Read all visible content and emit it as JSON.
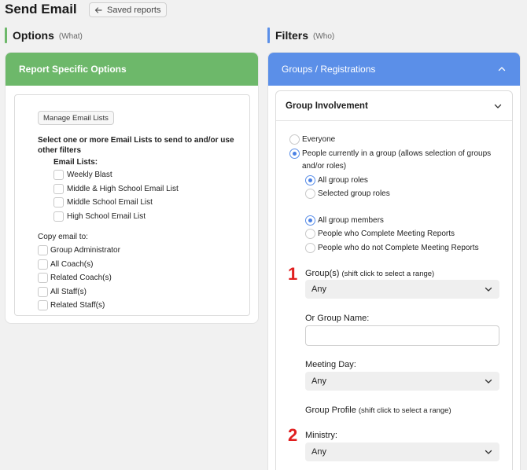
{
  "header": {
    "title": "Send Email",
    "back_label": "Saved reports"
  },
  "options_section": {
    "title": "Options",
    "subtitle": "(What)",
    "accent": "#6db86a"
  },
  "filters_section": {
    "title": "Filters",
    "subtitle": "(Who)",
    "accent": "#5b8fe8"
  },
  "report_options": {
    "title": "Report Specific Options",
    "manage_button": "Manage Email Lists",
    "instruction_line1": "Select one or more Email Lists to send to and/or use",
    "instruction_line2": "other filters",
    "email_lists_label": "Email Lists:",
    "email_lists": [
      "Weekly Blast",
      "Middle & High School Email List",
      "Middle School Email List",
      "High School Email List"
    ],
    "copy_label": "Copy email to:",
    "copy_options": [
      "Group Administrator",
      "All Coach(s)",
      "Related Coach(s)",
      "All Staff(s)",
      "Related Staff(s)"
    ]
  },
  "groups_panel": {
    "title": "Groups / Registrations",
    "involvement_title": "Group Involvement",
    "radio_everyone": "Everyone",
    "radio_in_group_line1": "People currently in a group (allows selection of groups",
    "radio_in_group_line2": "and/or roles)",
    "role_options": [
      "All group roles",
      "Selected group roles"
    ],
    "member_options": [
      "All group members",
      "People who Complete Meeting Reports",
      "People who do not Complete Meeting Reports"
    ],
    "groups_label": "Group(s)",
    "groups_hint": "(shift click to select a range)",
    "groups_value": "Any",
    "group_name_label": "Or Group Name:",
    "group_name_value": "",
    "meeting_day_label": "Meeting Day:",
    "meeting_day_value": "Any",
    "profile_label": "Group Profile",
    "profile_hint": "(shift click to select a range)",
    "ministry_label": "Ministry:",
    "ministry_value": "Any",
    "marker_1": "1",
    "marker_2": "2"
  },
  "icons": [
    "arrow-left-icon",
    "chevron-up-icon",
    "chevron-down-icon"
  ]
}
